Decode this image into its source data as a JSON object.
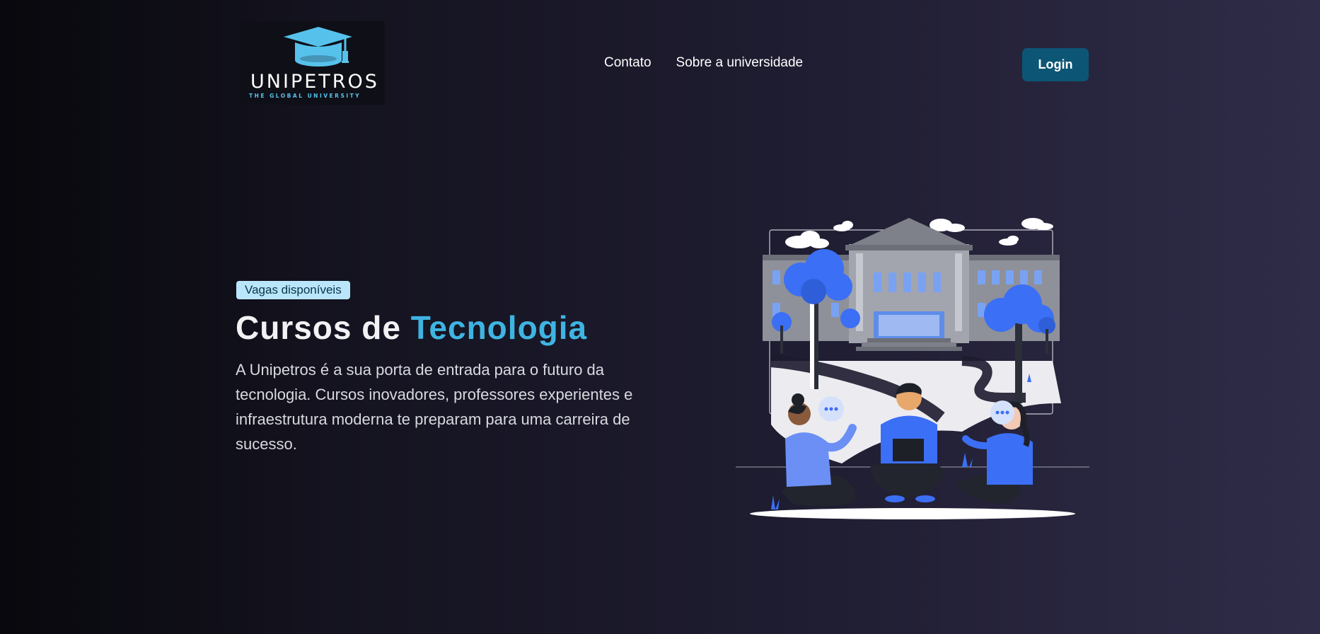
{
  "header": {
    "logo": {
      "name": "UNIPETROS",
      "tagline": "THE GLOBAL UNIVERSITY",
      "icon": "graduation-cap-icon",
      "colors": {
        "background": "#0f0f17",
        "cap": "#56c2ec",
        "text": "#ffffff",
        "tagline": "#56c2ec"
      }
    },
    "nav": [
      {
        "label": "Contato"
      },
      {
        "label": "Sobre a universidade"
      }
    ],
    "login_label": "Login"
  },
  "hero": {
    "badge": "Vagas disponíveis",
    "title_part1": "Cursos de ",
    "title_accent": "Tecnologia",
    "description": "A Unipetros é a sua porta de entrada para o futuro da tecnologia. Cursos inovadores, professores experientes e infraestrutura moderna te preparam para uma carreira de sucesso."
  },
  "colors": {
    "accent": "#3fb4e2",
    "button": "#0d5574",
    "badge_bg": "#b9e6fb",
    "illustration_blue": "#3b6ff5"
  },
  "illustration": {
    "subject": "university-students-illustration",
    "icons": [
      "building-icon",
      "tree-icon",
      "cloud-icon",
      "speech-bubble-icon",
      "student-icon"
    ]
  }
}
